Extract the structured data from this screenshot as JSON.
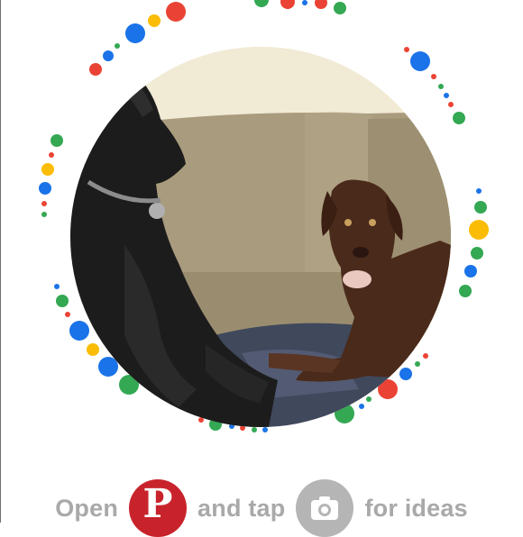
{
  "photo": {
    "subject": "two dogs on a couch",
    "colors": {
      "wall": "#ece3c9",
      "couch": "#a99b7d",
      "black_dog": "#1c1c1c",
      "brown_dog": "#4a2a1a",
      "blanket": "#40485c"
    }
  },
  "decor": {
    "dot_colors": {
      "blue": "#1a73e8",
      "red": "#ea4335",
      "yellow": "#fbbc05",
      "green": "#34a853"
    }
  },
  "instruction": {
    "open_text": "Open",
    "and_tap_text": "and tap",
    "for_ideas_text": "for ideas"
  },
  "icons": {
    "pinterest_logo": "pinterest-logo-icon",
    "camera": "camera-icon"
  },
  "colors": {
    "pinterest_red": "#c8232c",
    "camera_gray": "#b5b5b5",
    "text_gray": "#a9a9a9"
  }
}
